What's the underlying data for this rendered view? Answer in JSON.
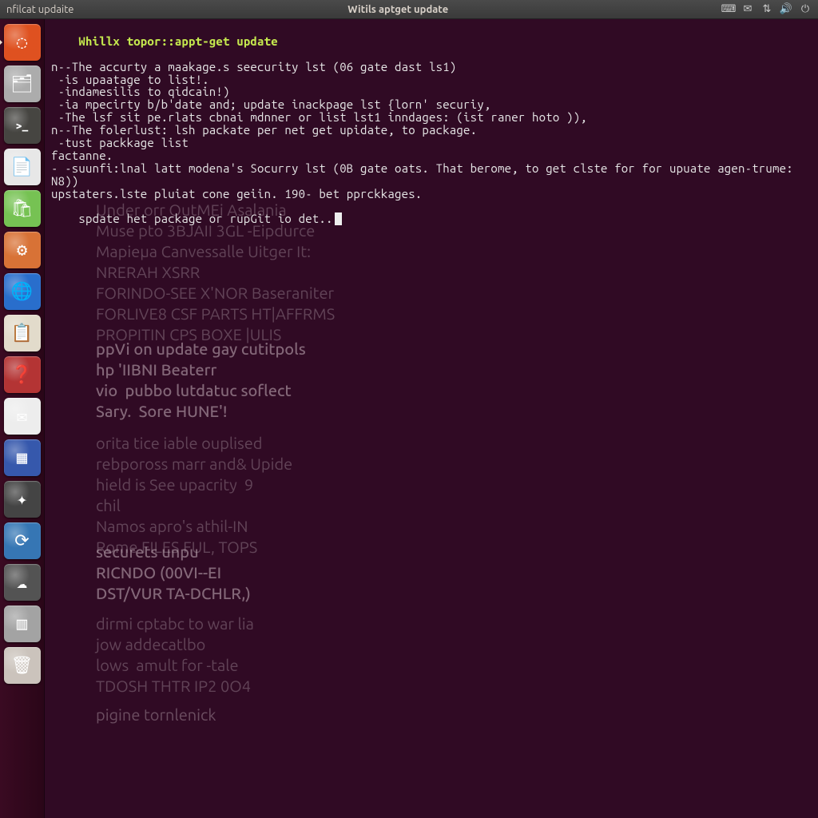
{
  "panel": {
    "left_title": "nfilcat updaite",
    "center_title": "Witils aptget update",
    "indicators": [
      "keyboard",
      "mail",
      "network",
      "sound",
      "power"
    ]
  },
  "launcher": {
    "items": [
      {
        "name": "dash-home-icon",
        "glyph": "◌",
        "bg": "#dd4814"
      },
      {
        "name": "files-icon",
        "glyph": "🗂",
        "bg": "#a8a8a8"
      },
      {
        "name": "terminal-icon",
        "glyph": ">_",
        "bg": "#3c3b37"
      },
      {
        "name": "text-editor-icon",
        "glyph": "📄",
        "bg": "#e6e6e6"
      },
      {
        "name": "software-center-icon",
        "glyph": "🛍",
        "bg": "#6fbf4a"
      },
      {
        "name": "settings-icon",
        "glyph": "⚙",
        "bg": "#d66a2b"
      },
      {
        "name": "browser-icon",
        "glyph": "🌐",
        "bg": "#1e66c9"
      },
      {
        "name": "document-icon",
        "glyph": "📋",
        "bg": "#e0d9c8"
      },
      {
        "name": "help-icon",
        "glyph": "❓",
        "bg": "#b02929"
      },
      {
        "name": "mail-icon",
        "glyph": "✉",
        "bg": "#ececec"
      },
      {
        "name": "app1-icon",
        "glyph": "▦",
        "bg": "#2b4fa8"
      },
      {
        "name": "app2-icon",
        "glyph": "✦",
        "bg": "#3a3a3a"
      },
      {
        "name": "updater-icon",
        "glyph": "⟳",
        "bg": "#2b6fb0"
      },
      {
        "name": "weather-icon",
        "glyph": "☁",
        "bg": "#4a4a4a"
      },
      {
        "name": "app3-icon",
        "glyph": "▥",
        "bg": "#9e9e9e"
      },
      {
        "name": "trash-icon",
        "glyph": "🗑",
        "bg": "#c8c0b8"
      }
    ]
  },
  "terminal": {
    "prompt_line": {
      "prompt": "Whillx topor::",
      "command": "appt-get update"
    },
    "output_lines": [
      "n--The accurty a maakage.s seecurity lst (06 gate dast ls1)",
      " -is upaatage to list!.",
      " -indamesilis to qidcain!)",
      " -ia mpecirty b/b'date and; update inackpage lst {lorn' securiy,",
      " -The lsf sit pe.rlats cbnai mdnner or list lst1 inndages: (ist raner hoto )),",
      "n--The folerlust: lsh packate per net get upidate, to package.",
      " -tust packkage list",
      "factanne.",
      "- -suunfi:lnal latt modena's Socurry lst (0B gate oats. That berome, to get clste for for upuate agen-trume: N8))",
      "upstaters.lste pluiat cone geiin. 190- bet pprckkages."
    ],
    "current_line": "spdate het package or rupGit io det.."
  },
  "ghost": {
    "b1": "Under orr OutMEi Asalania\nMuse pto 3BJAII 3GL -Eipdurce\nMapieμa Canvessalle Uitger It:\nNRERAH XSRR\nFORINDO-SEE X'NOR Baseraniter\nFORLIVE8 CSF PARTS HT|AFFRMS\nPROPITIN CPS BOXE |ULIS",
    "b2": "ppVi on update gay cutitpols\nhp 'IIBNI Beaterr\nvio  pubbo lutdatuc soflect\nSary.  Sore HUNE'!",
    "b3": "orita tice iable ouplised\nrebpoross marr and& Upide\nhield is See upacrity  9\nchil\nNamos apro's athil-IN\nRome FILES FUL, TOPS",
    "b4": "securets unpu\nRICNDO (00VI--EI\nDST/VUR TA-DCHLR,)",
    "b5": "dirmi cptabc to war lia\njow addecatlbo\nlows  amult for -tale\nTDOSH THTR IP2 0O4",
    "b6": "pigine tornlenick"
  },
  "colors": {
    "terminal_bg": "#300a24",
    "prompt": "#c4e84e",
    "text": "#e6e6e6",
    "panel_bg": "#3c3b37",
    "launcher_bg": "#2a0618"
  }
}
